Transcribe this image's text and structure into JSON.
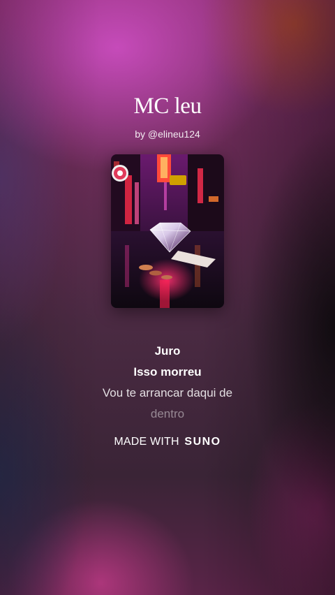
{
  "song": {
    "title": "MC leu",
    "byline": "by @elineu124"
  },
  "lyrics": {
    "lines": [
      "Juro",
      "Isso morreu",
      "Vou te arrancar daqui de",
      "dentro"
    ]
  },
  "footer": {
    "made_with": "MADE WITH",
    "brand": "SUNO"
  },
  "colors": {
    "accent_pink": "#c0409a",
    "text": "#ffffff"
  }
}
